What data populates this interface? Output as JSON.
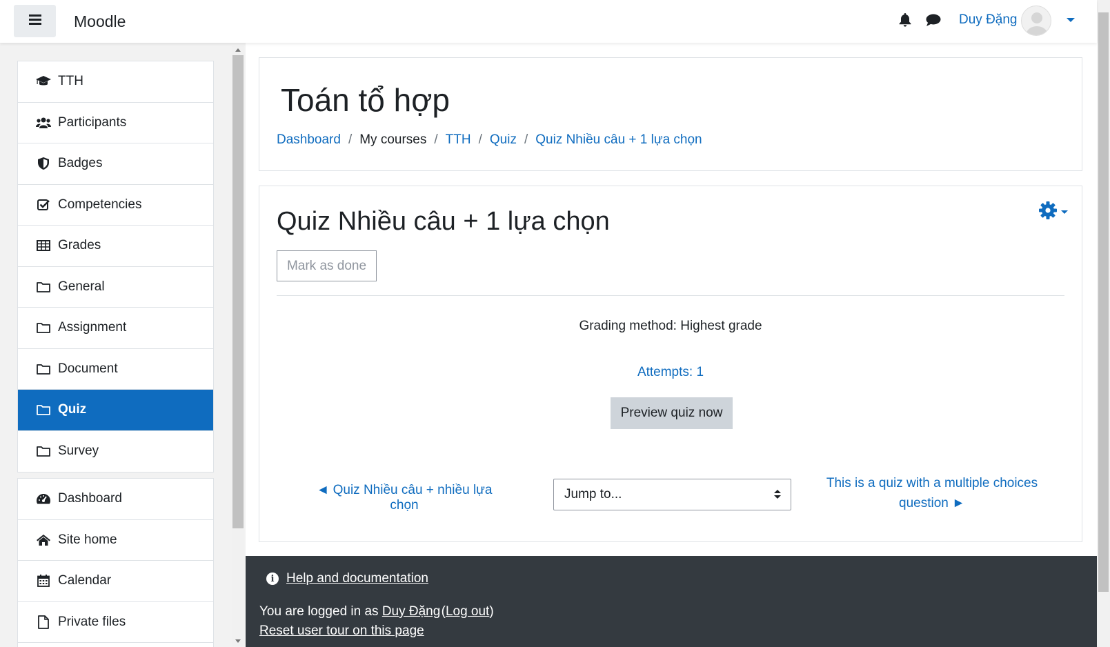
{
  "navbar": {
    "brand": "Moodle",
    "user_name": "Duy Đặng"
  },
  "drawer": {
    "course_items": [
      {
        "label": "TTH",
        "icon": "graduation-cap-icon"
      },
      {
        "label": "Participants",
        "icon": "users-icon"
      },
      {
        "label": "Badges",
        "icon": "shield-icon"
      },
      {
        "label": "Competencies",
        "icon": "check-square-icon"
      },
      {
        "label": "Grades",
        "icon": "table-icon"
      },
      {
        "label": "General",
        "icon": "folder-icon"
      },
      {
        "label": "Assignment",
        "icon": "folder-icon"
      },
      {
        "label": "Document",
        "icon": "folder-icon"
      },
      {
        "label": "Quiz",
        "icon": "folder-icon",
        "active": true
      },
      {
        "label": "Survey",
        "icon": "folder-icon"
      }
    ],
    "site_items": [
      {
        "label": "Dashboard",
        "icon": "tachometer-icon"
      },
      {
        "label": "Site home",
        "icon": "home-icon"
      },
      {
        "label": "Calendar",
        "icon": "calendar-icon"
      },
      {
        "label": "Private files",
        "icon": "file-icon"
      }
    ]
  },
  "header": {
    "course_title": "Toán tổ hợp",
    "breadcrumb": [
      {
        "label": "Dashboard",
        "link": true
      },
      {
        "label": "My courses",
        "link": false
      },
      {
        "label": "TTH",
        "link": true
      },
      {
        "label": "Quiz",
        "link": true
      },
      {
        "label": "Quiz Nhiều câu + 1 lựa chọn",
        "link": true
      }
    ],
    "breadcrumb_separator": "/"
  },
  "activity": {
    "title": "Quiz Nhiều câu + 1 lựa chọn",
    "mark_done_label": "Mark as done",
    "grading_method": "Grading method: Highest grade",
    "attempts": "Attempts: 1",
    "preview_button": "Preview quiz now",
    "prev_activity": "◄ Quiz Nhiều câu + nhiều lựa chọn",
    "jump_to": "Jump to...",
    "next_activity": "This is a quiz with a multiple choices question ►"
  },
  "footer": {
    "help_link": "Help and documentation",
    "logged_in_prefix": "You are logged in as ",
    "logged_in_user": "Duy Đặng",
    "logout_label": "Log out",
    "reset_tour": "Reset user tour on this page"
  },
  "colors": {
    "primary": "#0f6cbf",
    "footer_bg": "#343a40",
    "drawer_bg": "#f2f2f2"
  }
}
